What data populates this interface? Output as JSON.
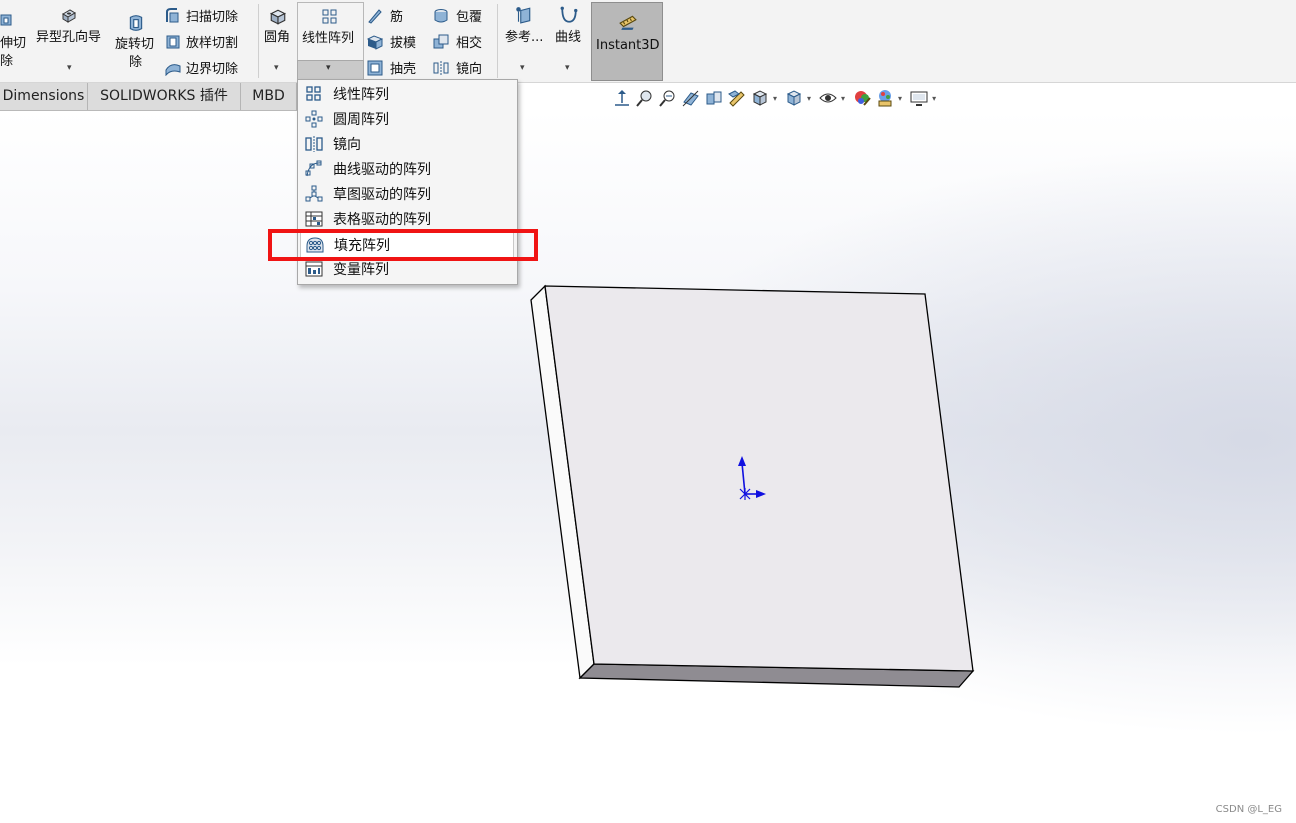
{
  "ribbon": {
    "extrude_cut": "伸切\n除",
    "extrude_cut_l1": "伸切",
    "extrude_cut_l2": "除",
    "hole_wizard": "异型孔向导",
    "revolve_cut_l1": "旋转切",
    "revolve_cut_l2": "除",
    "swept_cut": "扫描切除",
    "lofted_cut": "放样切割",
    "boundary_cut": "边界切除",
    "fillet": "圆角",
    "linear_pattern": "线性阵列",
    "rib": "筋",
    "draft": "拔模",
    "shell": "抽壳",
    "wrap": "包覆",
    "intersect": "相交",
    "mirror": "镜向",
    "reference": "参考...",
    "curves": "曲线",
    "instant3d": "Instant3D"
  },
  "tabs": [
    "Dimensions",
    "SOLIDWORKS 插件",
    "MBD"
  ],
  "menu": {
    "items": [
      {
        "label": "线性阵列",
        "icon": "linear-pattern-icon"
      },
      {
        "label": "圆周阵列",
        "icon": "circular-pattern-icon"
      },
      {
        "label": "镜向",
        "icon": "mirror-icon"
      },
      {
        "label": "曲线驱动的阵列",
        "icon": "curve-driven-pattern-icon"
      },
      {
        "label": "草图驱动的阵列",
        "icon": "sketch-driven-pattern-icon"
      },
      {
        "label": "表格驱动的阵列",
        "icon": "table-driven-pattern-icon"
      },
      {
        "label": "填充阵列",
        "icon": "fill-pattern-icon"
      },
      {
        "label": "变量阵列",
        "icon": "variable-pattern-icon"
      }
    ],
    "highlighted": "填充阵列"
  },
  "colors": {
    "highlight_border": "#f01414",
    "triad_blue": "#1010e0",
    "part_face": "#ebe9ed"
  },
  "watermark": "CSDN @L_EG"
}
